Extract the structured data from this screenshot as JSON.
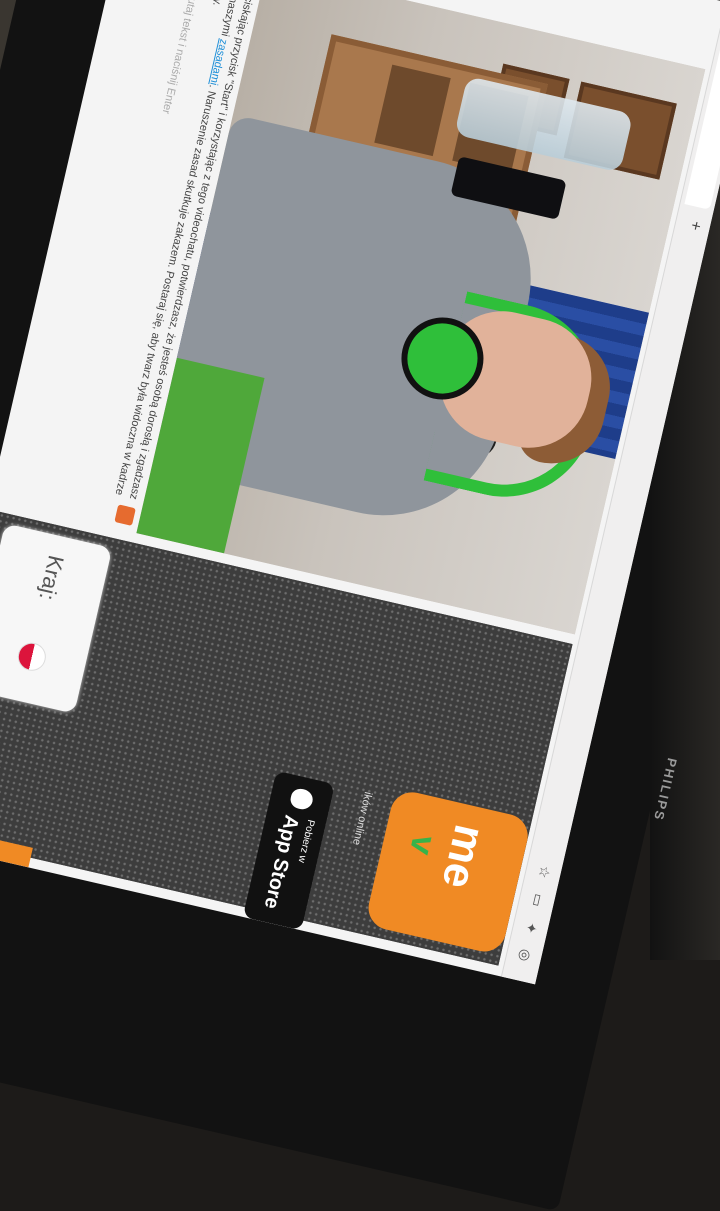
{
  "monitor": {
    "brand": "PHILIPS"
  },
  "browser": {
    "new_tab": "+"
  },
  "consent": {
    "line1": "Przyciskając przycisk \"Start\" i korzystając z tego videochatu, potwierdzasz, że jesteś osobą dorosłą i zgadzasz się",
    "line2_prefix": "z naszymi ",
    "link": "zasadami",
    "line2_suffix": ". Naruszenie zasad skutkuje zakazem. Postaraj się, aby twarz była widoczna w kadrze kamery.",
    "input_placeholder": "Wpisz tutaj tekst i naciśnij Enter"
  },
  "country": {
    "label": "Kraj:"
  },
  "logo": {
    "line1": "me",
    "line2": "v"
  },
  "tagline": "ików online",
  "app_store": {
    "small": "Pobierz w",
    "big": "App Store"
  },
  "colors": {
    "accent": "#f08a24",
    "link": "#1d8fd8",
    "headphones": "#2fbf3a"
  }
}
